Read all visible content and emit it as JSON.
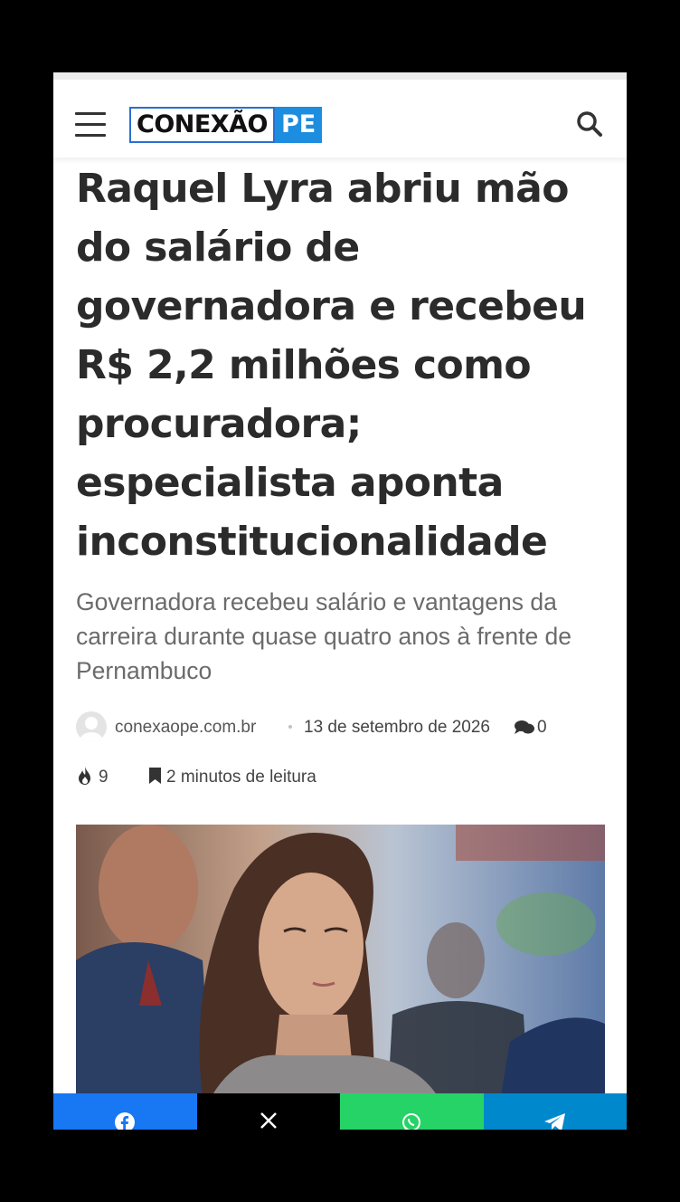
{
  "header": {
    "logo_left": "CONEXÃO",
    "logo_right": "PE",
    "menu_icon": "hamburger-menu-icon",
    "search_icon": "search-icon"
  },
  "article": {
    "title": "Raquel Lyra abriu mão do salário de governadora e recebeu R$ 2,2 milhões como procuradora; especialista aponta inconstitucionalidade",
    "subtitle": "Governadora recebeu salário e vantagens da carreira durante quase quatro anos à frente de Pernambuco",
    "author": "conexaope.com.br",
    "date": "13 de setembro de 2026",
    "comments": "0",
    "views": "9",
    "read_time": "2 minutos de leitura"
  },
  "share": [
    {
      "name": "facebook",
      "color": "#1877f2",
      "icon": "facebook-icon"
    },
    {
      "name": "x",
      "color": "#000000",
      "icon": "x-icon"
    },
    {
      "name": "whatsapp",
      "color": "#25d366",
      "icon": "whatsapp-icon"
    },
    {
      "name": "telegram",
      "color": "#0088cc",
      "icon": "telegram-icon"
    }
  ]
}
